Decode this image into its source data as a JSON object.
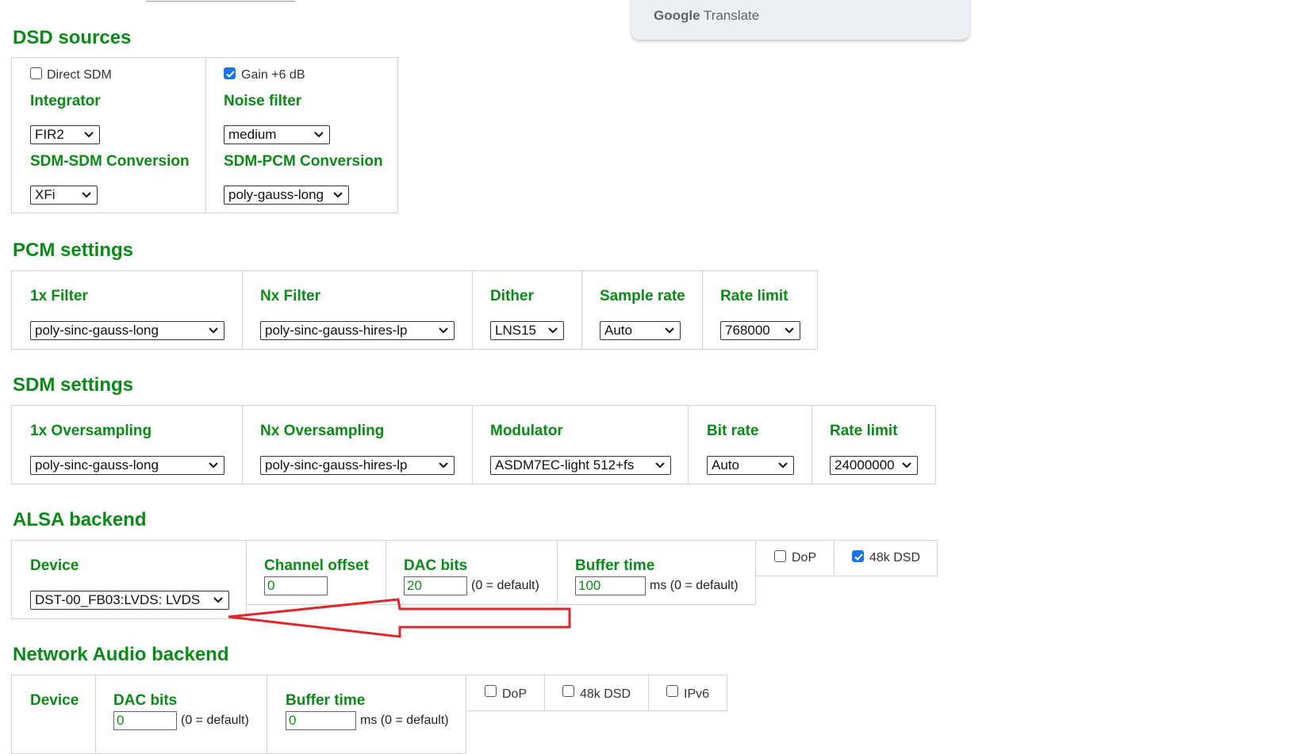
{
  "google_translate": {
    "brand": "Google",
    "product": "Translate"
  },
  "dsd": {
    "heading": "DSD sources",
    "col1": {
      "checkbox_label": "Direct SDM",
      "checked": false,
      "integrator_label": "Integrator",
      "integrator_value": "FIR2",
      "sdm_sdm_label": "SDM-SDM Conversion",
      "sdm_sdm_value": "XFi"
    },
    "col2": {
      "checkbox_label": "Gain +6 dB",
      "checked": true,
      "noise_label": "Noise filter",
      "noise_value": "medium",
      "sdm_pcm_label": "SDM-PCM Conversion",
      "sdm_pcm_value": "poly-gauss-long"
    }
  },
  "pcm": {
    "heading": "PCM settings",
    "filter1x_label": "1x Filter",
    "filter1x_value": "poly-sinc-gauss-long",
    "filterNx_label": "Nx Filter",
    "filterNx_value": "poly-sinc-gauss-hires-lp",
    "dither_label": "Dither",
    "dither_value": "LNS15",
    "samplerate_label": "Sample rate",
    "samplerate_value": "Auto",
    "ratelimit_label": "Rate limit",
    "ratelimit_value": "768000"
  },
  "sdm": {
    "heading": "SDM settings",
    "os1x_label": "1x Oversampling",
    "os1x_value": "poly-sinc-gauss-long",
    "osNx_label": "Nx Oversampling",
    "osNx_value": "poly-sinc-gauss-hires-lp",
    "modulator_label": "Modulator",
    "modulator_value": "ASDM7EC-light 512+fs",
    "bitrate_label": "Bit rate",
    "bitrate_value": "Auto",
    "ratelimit_label": "Rate limit",
    "ratelimit_value": "24000000"
  },
  "alsa": {
    "heading": "ALSA backend",
    "device_label": "Device",
    "device_value": "DST-00_FB03:LVDS: LVDS",
    "channel_offset_label": "Channel offset",
    "channel_offset_value": "0",
    "dac_bits_label": "DAC bits",
    "dac_bits_value": "20",
    "dac_bits_hint": "(0 = default)",
    "buffer_label": "Buffer time",
    "buffer_value": "100",
    "buffer_hint": "ms (0 = default)",
    "dop_label": "DoP",
    "dop_checked": false,
    "dsd48k_label": "48k DSD",
    "dsd48k_checked": true
  },
  "network": {
    "heading": "Network Audio backend",
    "device_label": "Device",
    "dac_bits_label": "DAC bits",
    "dac_bits_value": "0",
    "dac_bits_hint": "(0 = default)",
    "buffer_label": "Buffer time",
    "buffer_value": "0",
    "buffer_hint": "ms (0 = default)",
    "dop_label": "DoP",
    "dsd48k_label": "48k DSD",
    "ipv6_label": "IPv6"
  },
  "colors": {
    "heading_green": "#0b8a17",
    "annotation_red": "#e0262a",
    "checkbox_blue": "#1a73e8"
  }
}
